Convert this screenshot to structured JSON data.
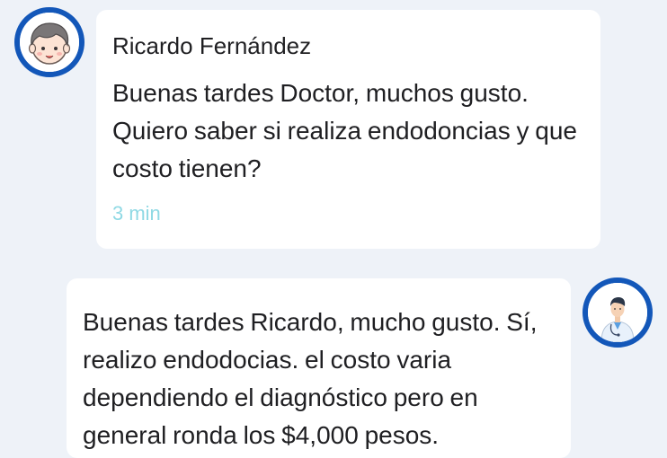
{
  "messages": [
    {
      "sender": "Ricardo Fernández",
      "text": "Buenas tardes Doctor, muchos gusto. Quiero saber si realiza endodoncias y que costo tienen?",
      "time": "3 min"
    },
    {
      "text": "Buenas tardes Ricardo, mucho gusto. Sí, realizo endodocias. el costo varia dependiendo el diagnóstico pero en general ronda los $4,000 pesos."
    }
  ],
  "colors": {
    "background": "#eef2f8",
    "avatar_ring": "#1357b9",
    "time_text": "#8fd9e4",
    "bubble": "#ffffff"
  },
  "icons": {
    "patient_avatar": "boy-avatar-icon",
    "doctor_avatar": "doctor-avatar-icon"
  }
}
